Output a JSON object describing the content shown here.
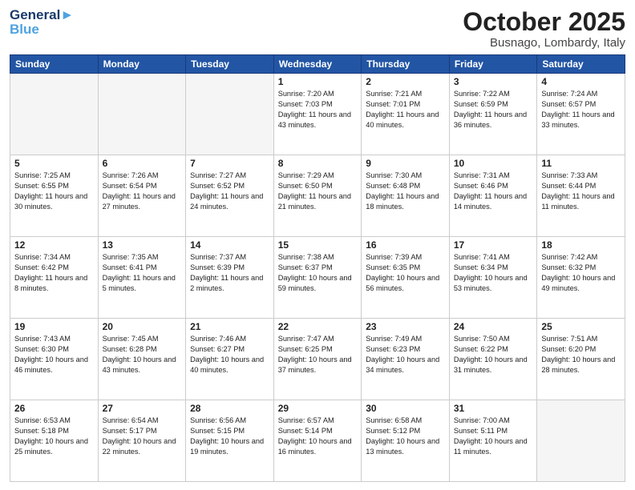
{
  "logo": {
    "line1": "General",
    "line2": "Blue"
  },
  "title": "October 2025",
  "location": "Busnago, Lombardy, Italy",
  "days_of_week": [
    "Sunday",
    "Monday",
    "Tuesday",
    "Wednesday",
    "Thursday",
    "Friday",
    "Saturday"
  ],
  "weeks": [
    [
      {
        "day": "",
        "info": ""
      },
      {
        "day": "",
        "info": ""
      },
      {
        "day": "",
        "info": ""
      },
      {
        "day": "1",
        "info": "Sunrise: 7:20 AM\nSunset: 7:03 PM\nDaylight: 11 hours\nand 43 minutes."
      },
      {
        "day": "2",
        "info": "Sunrise: 7:21 AM\nSunset: 7:01 PM\nDaylight: 11 hours\nand 40 minutes."
      },
      {
        "day": "3",
        "info": "Sunrise: 7:22 AM\nSunset: 6:59 PM\nDaylight: 11 hours\nand 36 minutes."
      },
      {
        "day": "4",
        "info": "Sunrise: 7:24 AM\nSunset: 6:57 PM\nDaylight: 11 hours\nand 33 minutes."
      }
    ],
    [
      {
        "day": "5",
        "info": "Sunrise: 7:25 AM\nSunset: 6:55 PM\nDaylight: 11 hours\nand 30 minutes."
      },
      {
        "day": "6",
        "info": "Sunrise: 7:26 AM\nSunset: 6:54 PM\nDaylight: 11 hours\nand 27 minutes."
      },
      {
        "day": "7",
        "info": "Sunrise: 7:27 AM\nSunset: 6:52 PM\nDaylight: 11 hours\nand 24 minutes."
      },
      {
        "day": "8",
        "info": "Sunrise: 7:29 AM\nSunset: 6:50 PM\nDaylight: 11 hours\nand 21 minutes."
      },
      {
        "day": "9",
        "info": "Sunrise: 7:30 AM\nSunset: 6:48 PM\nDaylight: 11 hours\nand 18 minutes."
      },
      {
        "day": "10",
        "info": "Sunrise: 7:31 AM\nSunset: 6:46 PM\nDaylight: 11 hours\nand 14 minutes."
      },
      {
        "day": "11",
        "info": "Sunrise: 7:33 AM\nSunset: 6:44 PM\nDaylight: 11 hours\nand 11 minutes."
      }
    ],
    [
      {
        "day": "12",
        "info": "Sunrise: 7:34 AM\nSunset: 6:42 PM\nDaylight: 11 hours\nand 8 minutes."
      },
      {
        "day": "13",
        "info": "Sunrise: 7:35 AM\nSunset: 6:41 PM\nDaylight: 11 hours\nand 5 minutes."
      },
      {
        "day": "14",
        "info": "Sunrise: 7:37 AM\nSunset: 6:39 PM\nDaylight: 11 hours\nand 2 minutes."
      },
      {
        "day": "15",
        "info": "Sunrise: 7:38 AM\nSunset: 6:37 PM\nDaylight: 10 hours\nand 59 minutes."
      },
      {
        "day": "16",
        "info": "Sunrise: 7:39 AM\nSunset: 6:35 PM\nDaylight: 10 hours\nand 56 minutes."
      },
      {
        "day": "17",
        "info": "Sunrise: 7:41 AM\nSunset: 6:34 PM\nDaylight: 10 hours\nand 53 minutes."
      },
      {
        "day": "18",
        "info": "Sunrise: 7:42 AM\nSunset: 6:32 PM\nDaylight: 10 hours\nand 49 minutes."
      }
    ],
    [
      {
        "day": "19",
        "info": "Sunrise: 7:43 AM\nSunset: 6:30 PM\nDaylight: 10 hours\nand 46 minutes."
      },
      {
        "day": "20",
        "info": "Sunrise: 7:45 AM\nSunset: 6:28 PM\nDaylight: 10 hours\nand 43 minutes."
      },
      {
        "day": "21",
        "info": "Sunrise: 7:46 AM\nSunset: 6:27 PM\nDaylight: 10 hours\nand 40 minutes."
      },
      {
        "day": "22",
        "info": "Sunrise: 7:47 AM\nSunset: 6:25 PM\nDaylight: 10 hours\nand 37 minutes."
      },
      {
        "day": "23",
        "info": "Sunrise: 7:49 AM\nSunset: 6:23 PM\nDaylight: 10 hours\nand 34 minutes."
      },
      {
        "day": "24",
        "info": "Sunrise: 7:50 AM\nSunset: 6:22 PM\nDaylight: 10 hours\nand 31 minutes."
      },
      {
        "day": "25",
        "info": "Sunrise: 7:51 AM\nSunset: 6:20 PM\nDaylight: 10 hours\nand 28 minutes."
      }
    ],
    [
      {
        "day": "26",
        "info": "Sunrise: 6:53 AM\nSunset: 5:18 PM\nDaylight: 10 hours\nand 25 minutes."
      },
      {
        "day": "27",
        "info": "Sunrise: 6:54 AM\nSunset: 5:17 PM\nDaylight: 10 hours\nand 22 minutes."
      },
      {
        "day": "28",
        "info": "Sunrise: 6:56 AM\nSunset: 5:15 PM\nDaylight: 10 hours\nand 19 minutes."
      },
      {
        "day": "29",
        "info": "Sunrise: 6:57 AM\nSunset: 5:14 PM\nDaylight: 10 hours\nand 16 minutes."
      },
      {
        "day": "30",
        "info": "Sunrise: 6:58 AM\nSunset: 5:12 PM\nDaylight: 10 hours\nand 13 minutes."
      },
      {
        "day": "31",
        "info": "Sunrise: 7:00 AM\nSunset: 5:11 PM\nDaylight: 10 hours\nand 11 minutes."
      },
      {
        "day": "",
        "info": ""
      }
    ]
  ]
}
